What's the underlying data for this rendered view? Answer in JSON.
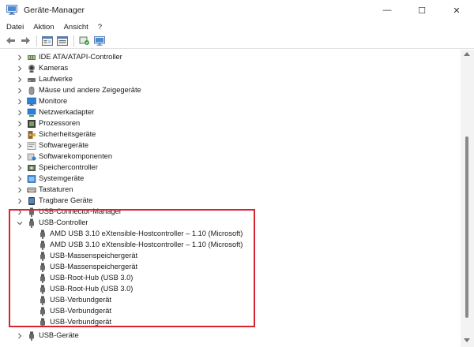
{
  "window": {
    "title": "Geräte-Manager",
    "minimize": "—",
    "maximize": "☐",
    "close": "✕"
  },
  "menu": {
    "items": [
      "Datei",
      "Aktion",
      "Ansicht",
      "?"
    ]
  },
  "toolbar": {
    "buttons": [
      "back",
      "forward",
      "properties",
      "show-hidden",
      "scan",
      "monitor"
    ]
  },
  "tree": {
    "categories": [
      {
        "label": "IDE ATA/ATAPI-Controller",
        "icon": "ide-icon",
        "expanded": false
      },
      {
        "label": "Kameras",
        "icon": "camera-icon",
        "expanded": false
      },
      {
        "label": "Laufwerke",
        "icon": "drive-icon",
        "expanded": false
      },
      {
        "label": "Mäuse und andere Zeigegeräte",
        "icon": "mouse-icon",
        "expanded": false
      },
      {
        "label": "Monitore",
        "icon": "monitor-icon",
        "expanded": false
      },
      {
        "label": "Netzwerkadapter",
        "icon": "network-icon",
        "expanded": false
      },
      {
        "label": "Prozessoren",
        "icon": "cpu-icon",
        "expanded": false
      },
      {
        "label": "Sicherheitsgeräte",
        "icon": "security-icon",
        "expanded": false
      },
      {
        "label": "Softwaregeräte",
        "icon": "software-device-icon",
        "expanded": false
      },
      {
        "label": "Softwarekomponenten",
        "icon": "software-component-icon",
        "expanded": false
      },
      {
        "label": "Speichercontroller",
        "icon": "storage-controller-icon",
        "expanded": false
      },
      {
        "label": "Systemgeräte",
        "icon": "system-device-icon",
        "expanded": false
      },
      {
        "label": "Tastaturen",
        "icon": "keyboard-icon",
        "expanded": false
      },
      {
        "label": "Tragbare Geräte",
        "icon": "portable-device-icon",
        "expanded": false
      },
      {
        "label": "USB-Connector-Manager",
        "icon": "usb-icon",
        "expanded": false
      },
      {
        "label": "USB-Controller",
        "icon": "usb-icon",
        "expanded": true
      },
      {
        "label": "USB-Geräte",
        "icon": "usb-icon",
        "expanded": false
      }
    ],
    "usb_controller_children": [
      "AMD USB 3.10 eXtensible-Hostcontroller – 1.10 (Microsoft)",
      "AMD USB 3.10 eXtensible-Hostcontroller – 1.10 (Microsoft)",
      "USB-Massenspeichergerät",
      "USB-Massenspeichergerät",
      "USB-Root-Hub (USB 3.0)",
      "USB-Root-Hub (USB 3.0)",
      "USB-Verbundgerät",
      "USB-Verbundgerät",
      "USB-Verbundgerät"
    ]
  },
  "colors": {
    "highlight_border": "#d8242f",
    "accent_blue": "#2b6cc4"
  }
}
